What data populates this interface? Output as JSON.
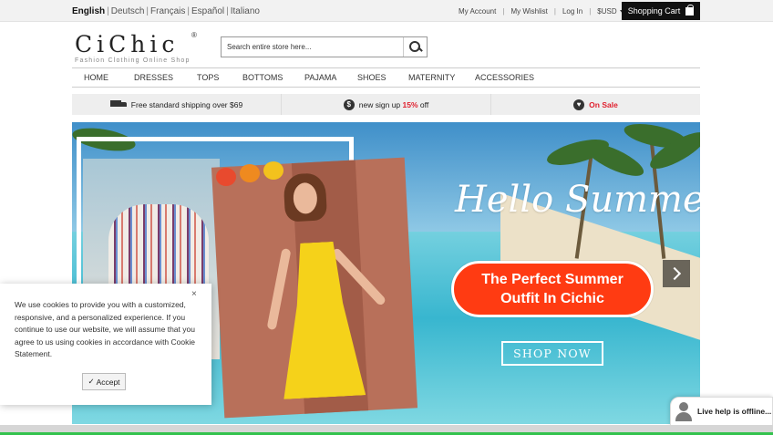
{
  "languages": [
    {
      "label": "English",
      "active": true
    },
    {
      "label": "Deutsch"
    },
    {
      "label": "Français"
    },
    {
      "label": "Español"
    },
    {
      "label": "Italiano"
    }
  ],
  "account_links": {
    "my_account": "My Account",
    "my_wishlist": "My Wishlist",
    "log_in": "Log In",
    "currency": "$USD",
    "separator": "|"
  },
  "cart": {
    "label": "Shopping Cart",
    "icon": "shopping-bag-icon"
  },
  "logo": {
    "name": "CiChic",
    "registered": "®",
    "tagline": "Fashion Clothing Online Shop"
  },
  "search": {
    "placeholder": "Search entire store here...",
    "icon": "search-icon"
  },
  "nav": [
    "HOME",
    "DRESSES",
    "TOPS",
    "BOTTOMS",
    "PAJAMA",
    "SHOES",
    "MATERNITY",
    "ACCESSORIES"
  ],
  "promo": {
    "shipping": {
      "text": "Free standard shipping over $69",
      "icon": "truck-icon"
    },
    "signup": {
      "text_before": "new sign up ",
      "highlight": "15%",
      "text_after": " off",
      "icon": "dollar-icon"
    },
    "sale": {
      "text": "On Sale",
      "icon": "heart-icon"
    }
  },
  "banner": {
    "script_title": "Hello Summer",
    "pill_line1": "The Perfect Summer",
    "pill_line2": "Outfit In Cichic",
    "button": "SHOP NOW",
    "accent_color": "#ff3b12"
  },
  "cookie": {
    "text": "We use cookies to provide you with a customized, responsive, and a personalized experience. If you continue to use our website, we will assume that you agree to us using cookies in accordance with Cookie Statement.",
    "accept": "Accept",
    "close": "×"
  },
  "live_help": {
    "text": "Live help is offline..."
  }
}
